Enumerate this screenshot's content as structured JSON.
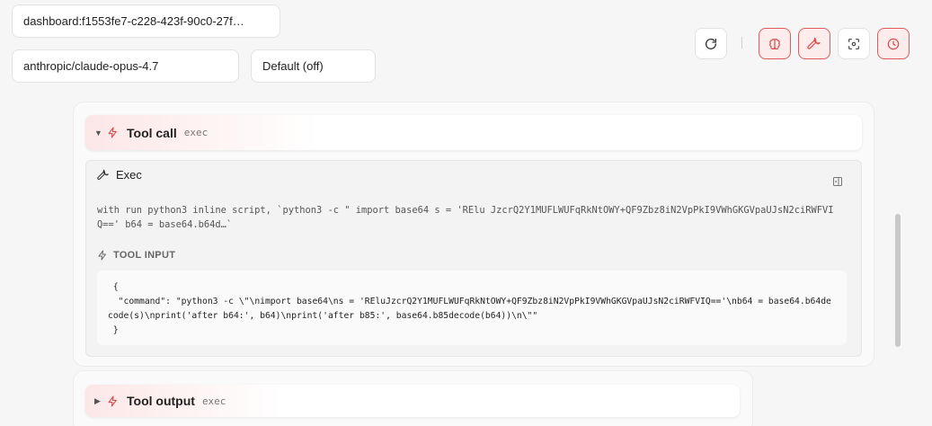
{
  "session": {
    "value": "dashboard:f1553fe7-c228-423f-90c0-27f…"
  },
  "model": {
    "value": "anthropic/claude-opus-4.7"
  },
  "thinking": {
    "value": "Default (off)"
  },
  "toolbar": {
    "buttons": [
      {
        "icon": "refresh-icon",
        "active": false
      },
      {
        "icon": "brain-icon",
        "active": true
      },
      {
        "icon": "wrench-icon",
        "active": true
      },
      {
        "icon": "focus-icon",
        "active": false
      },
      {
        "icon": "clock-icon",
        "active": true
      }
    ]
  },
  "tool_call": {
    "title": "Tool call",
    "subtitle": "exec",
    "exec_title": "Exec",
    "description": "with run python3 inline script, `python3 -c \" import base64 s = 'RElu JzcrQ2Y1MUFLWUFqRkNtOWY+QF9Zbz8iN2VpPkI9VWhGKGVpaUJsN2ciRWFVIQ==' b64 = base64.b64d…`",
    "input_label": "TOOL INPUT",
    "input_code": " {\n  \"command\": \"python3 -c \\\"\\nimport base64\\ns = 'REluJzcrQ2Y1MUFLWUFqRkNtOWY+QF9Zbz8iN2VpPkI9VWhGKGVpaUJsN2ciRWFVIQ=='\\nb64 = base64.b64decode(s)\\nprint('after b64:', b64)\\nprint('after b85:', base64.b85decode(b64))\\n\\\"\"\n }"
  },
  "tool_output": {
    "title": "Tool output",
    "subtitle": "exec"
  },
  "colors": {
    "accent": "#e05a5a",
    "accent_bg": "#fdecec"
  }
}
